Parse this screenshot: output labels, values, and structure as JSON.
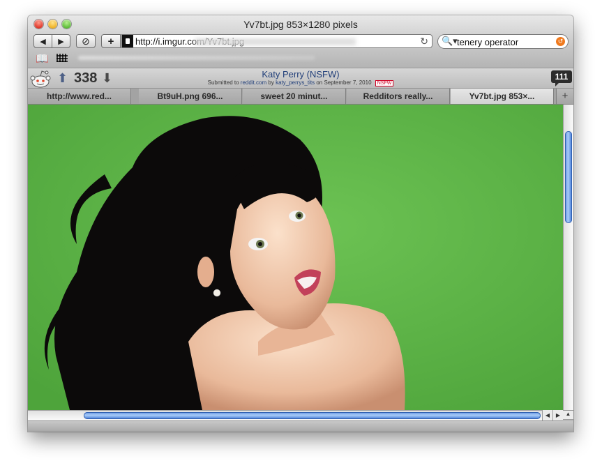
{
  "window": {
    "title": "Yv7bt.jpg 853×1280 pixels"
  },
  "toolbar": {
    "back_glyph": "◀",
    "forward_glyph": "▶",
    "stop_glyph": "⊘",
    "add_glyph": "+",
    "url": "http://i.imgur.com/Yv7bt.jpg",
    "reload_glyph": "↻",
    "search_value": "tenery operator",
    "search_glyph": "🔍▾",
    "snapback_glyph": "↺"
  },
  "bookmarks": {
    "book_glyph": "📖"
  },
  "reddit": {
    "score": "338",
    "up_glyph": "⬆",
    "down_glyph": "⬇",
    "post_title": "Katy Perry (NSFW)",
    "submitted_prefix": "Submitted to",
    "subreddit": "reddit.com",
    "by_word": "by",
    "author": "katy_perrys_tits",
    "date_text": "on September 7, 2010",
    "nsfw_label": "NSFW",
    "comment_count": "111"
  },
  "tabs": [
    {
      "label": "http://www.red..."
    },
    {
      "label": "Bt9uH.png 696..."
    },
    {
      "label": "sweet 20 minut..."
    },
    {
      "label": "Redditors really..."
    },
    {
      "label": "Yv7bt.jpg 853×..."
    }
  ],
  "tab_add_glyph": "+",
  "scroll": {
    "up": "▲",
    "down": "▼",
    "left": "◀",
    "right": "▶"
  },
  "colors": {
    "image_background": "#5fb548",
    "accent_blue": "#3f74d3",
    "reddit_link": "#23407a",
    "nsfw": "#d10023"
  },
  "icons": [
    "back-icon",
    "forward-icon",
    "stop-icon",
    "add-bookmark-icon",
    "lock-icon",
    "reload-icon",
    "search-icon",
    "snapback-icon",
    "bookmarks-book-icon",
    "top-sites-grid-icon",
    "reddit-alien-icon",
    "upvote-icon",
    "downvote-icon",
    "comments-icon"
  ]
}
